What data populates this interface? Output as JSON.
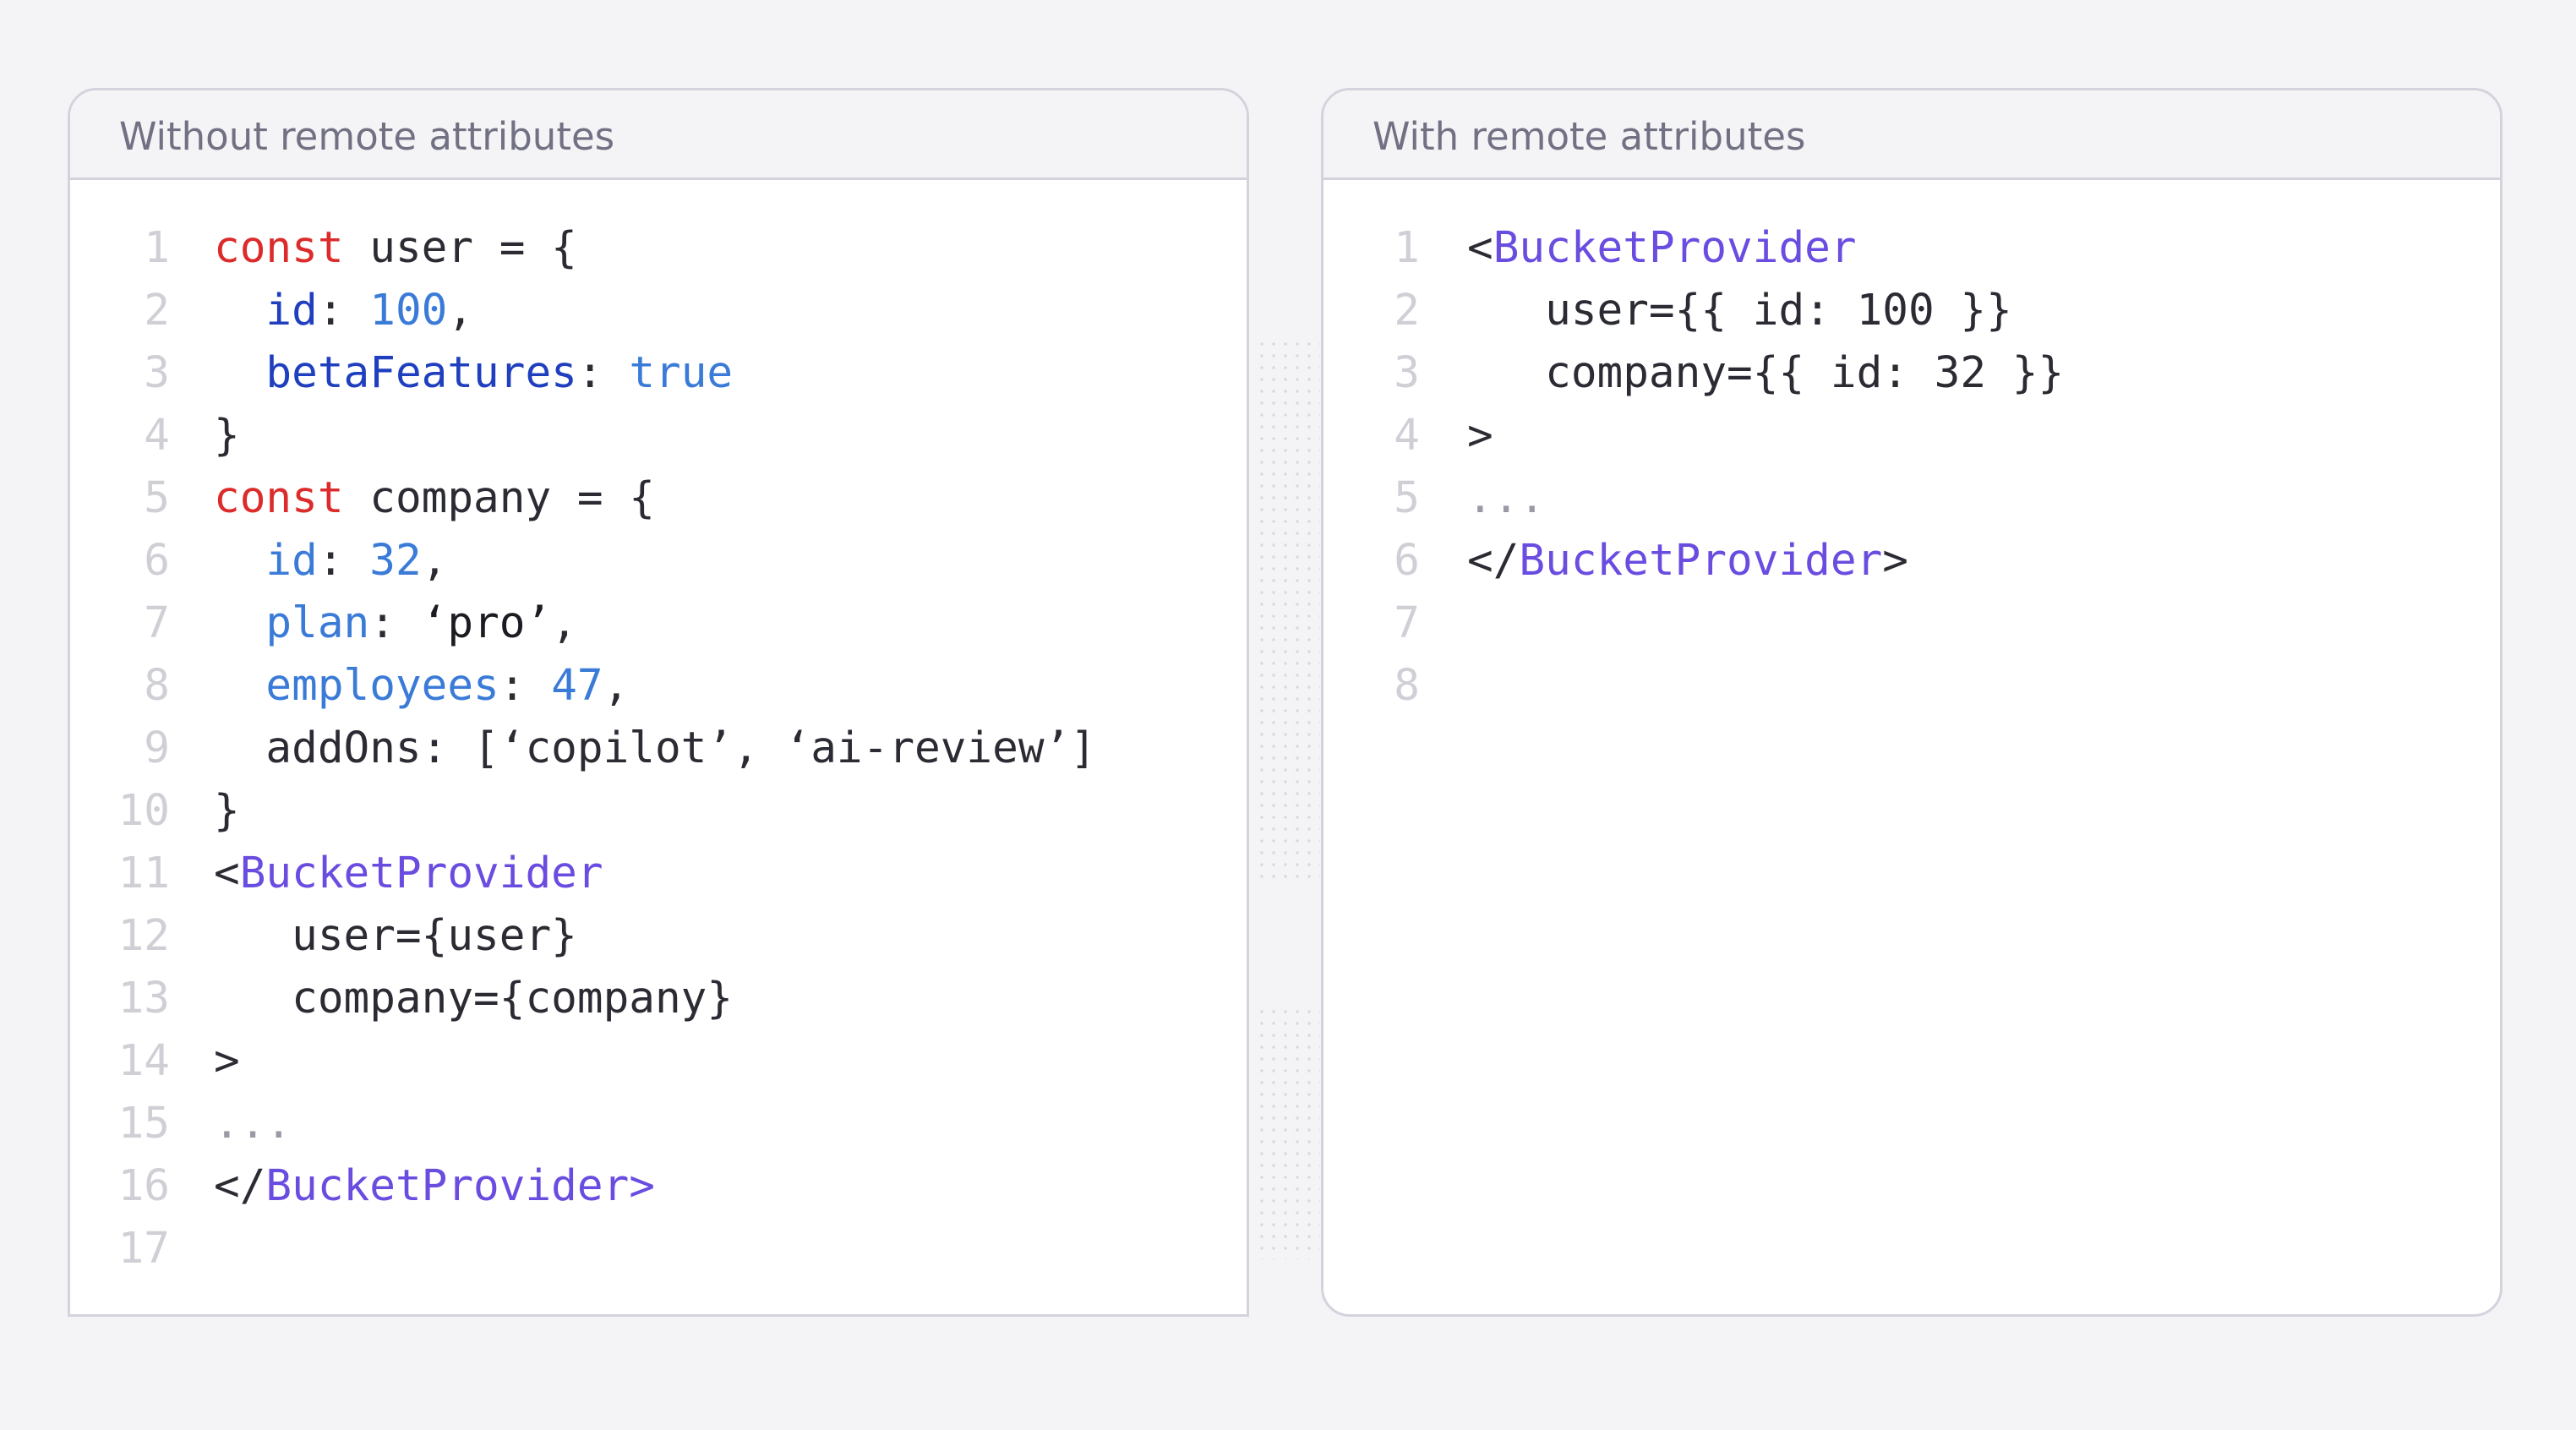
{
  "colors": {
    "background": "#f4f4f7",
    "panel_border": "#d4d3dd",
    "keyword": "#dc2b2b",
    "property": "#1f3fbf",
    "property_light": "#3b7bd8",
    "number": "#3b7bd8",
    "component": "#6a4ce0",
    "line_number": "#cfcfd6"
  },
  "left_panel": {
    "title": "Without remote attributes",
    "lines": [
      {
        "num": "1",
        "tokens": [
          {
            "t": "const",
            "c": "keyword"
          },
          {
            "t": " user = {",
            "c": "plain"
          }
        ]
      },
      {
        "num": "2",
        "tokens": [
          {
            "t": "  ",
            "c": "plain"
          },
          {
            "t": "id",
            "c": "prop"
          },
          {
            "t": ": ",
            "c": "plain"
          },
          {
            "t": "100",
            "c": "num"
          },
          {
            "t": ",",
            "c": "plain"
          }
        ]
      },
      {
        "num": "3",
        "tokens": [
          {
            "t": "  ",
            "c": "plain"
          },
          {
            "t": "betaFeatures",
            "c": "prop"
          },
          {
            "t": ": ",
            "c": "plain"
          },
          {
            "t": "true",
            "c": "bool"
          }
        ]
      },
      {
        "num": "4",
        "tokens": [
          {
            "t": "}",
            "c": "plain"
          }
        ]
      },
      {
        "num": "5",
        "tokens": [
          {
            "t": "const",
            "c": "keyword"
          },
          {
            "t": " company = {",
            "c": "plain"
          }
        ]
      },
      {
        "num": "6",
        "tokens": [
          {
            "t": "  ",
            "c": "plain"
          },
          {
            "t": "id",
            "c": "propl"
          },
          {
            "t": ": ",
            "c": "plain"
          },
          {
            "t": "32",
            "c": "num"
          },
          {
            "t": ",",
            "c": "plain"
          }
        ]
      },
      {
        "num": "7",
        "tokens": [
          {
            "t": "  ",
            "c": "plain"
          },
          {
            "t": "plan",
            "c": "propl"
          },
          {
            "t": ": ",
            "c": "plain"
          },
          {
            "t": "‘pro’",
            "c": "str"
          },
          {
            "t": ",",
            "c": "plain"
          }
        ]
      },
      {
        "num": "8",
        "tokens": [
          {
            "t": "  ",
            "c": "plain"
          },
          {
            "t": "employees",
            "c": "propl"
          },
          {
            "t": ": ",
            "c": "plain"
          },
          {
            "t": "47",
            "c": "num"
          },
          {
            "t": ",",
            "c": "plain"
          }
        ]
      },
      {
        "num": "9",
        "tokens": [
          {
            "t": "  addOns: [‘copilot’, ‘ai-review’]",
            "c": "plain"
          }
        ]
      },
      {
        "num": "10",
        "tokens": [
          {
            "t": "}",
            "c": "plain"
          }
        ]
      },
      {
        "num": "11",
        "tokens": [
          {
            "t": "<",
            "c": "plain"
          },
          {
            "t": "BucketProvider",
            "c": "comp"
          }
        ]
      },
      {
        "num": "12",
        "tokens": [
          {
            "t": "   user={user}",
            "c": "plain"
          }
        ]
      },
      {
        "num": "13",
        "tokens": [
          {
            "t": "   company={company}",
            "c": "plain"
          }
        ]
      },
      {
        "num": "14",
        "tokens": [
          {
            "t": ">",
            "c": "plain"
          }
        ]
      },
      {
        "num": "15",
        "tokens": [
          {
            "t": "...",
            "c": "ellipsis"
          }
        ]
      },
      {
        "num": "16",
        "tokens": [
          {
            "t": "</",
            "c": "plain"
          },
          {
            "t": "BucketProvider>",
            "c": "comp"
          }
        ]
      },
      {
        "num": "17",
        "tokens": []
      }
    ]
  },
  "right_panel": {
    "title": "With remote attributes",
    "lines": [
      {
        "num": "1",
        "tokens": [
          {
            "t": "<",
            "c": "plain"
          },
          {
            "t": "BucketProvider",
            "c": "comp"
          }
        ]
      },
      {
        "num": "2",
        "tokens": [
          {
            "t": "   user={{ id: 100 }}",
            "c": "plain"
          }
        ]
      },
      {
        "num": "3",
        "tokens": [
          {
            "t": "   company={{ id: 32 }}",
            "c": "plain"
          }
        ]
      },
      {
        "num": "4",
        "tokens": [
          {
            "t": ">",
            "c": "plain"
          }
        ]
      },
      {
        "num": "5",
        "tokens": [
          {
            "t": "...",
            "c": "ellipsis"
          }
        ]
      },
      {
        "num": "6",
        "tokens": [
          {
            "t": "</",
            "c": "plain"
          },
          {
            "t": "BucketProvider",
            "c": "comp"
          },
          {
            "t": ">",
            "c": "plain"
          }
        ]
      },
      {
        "num": "7",
        "tokens": []
      },
      {
        "num": "8",
        "tokens": []
      }
    ]
  }
}
